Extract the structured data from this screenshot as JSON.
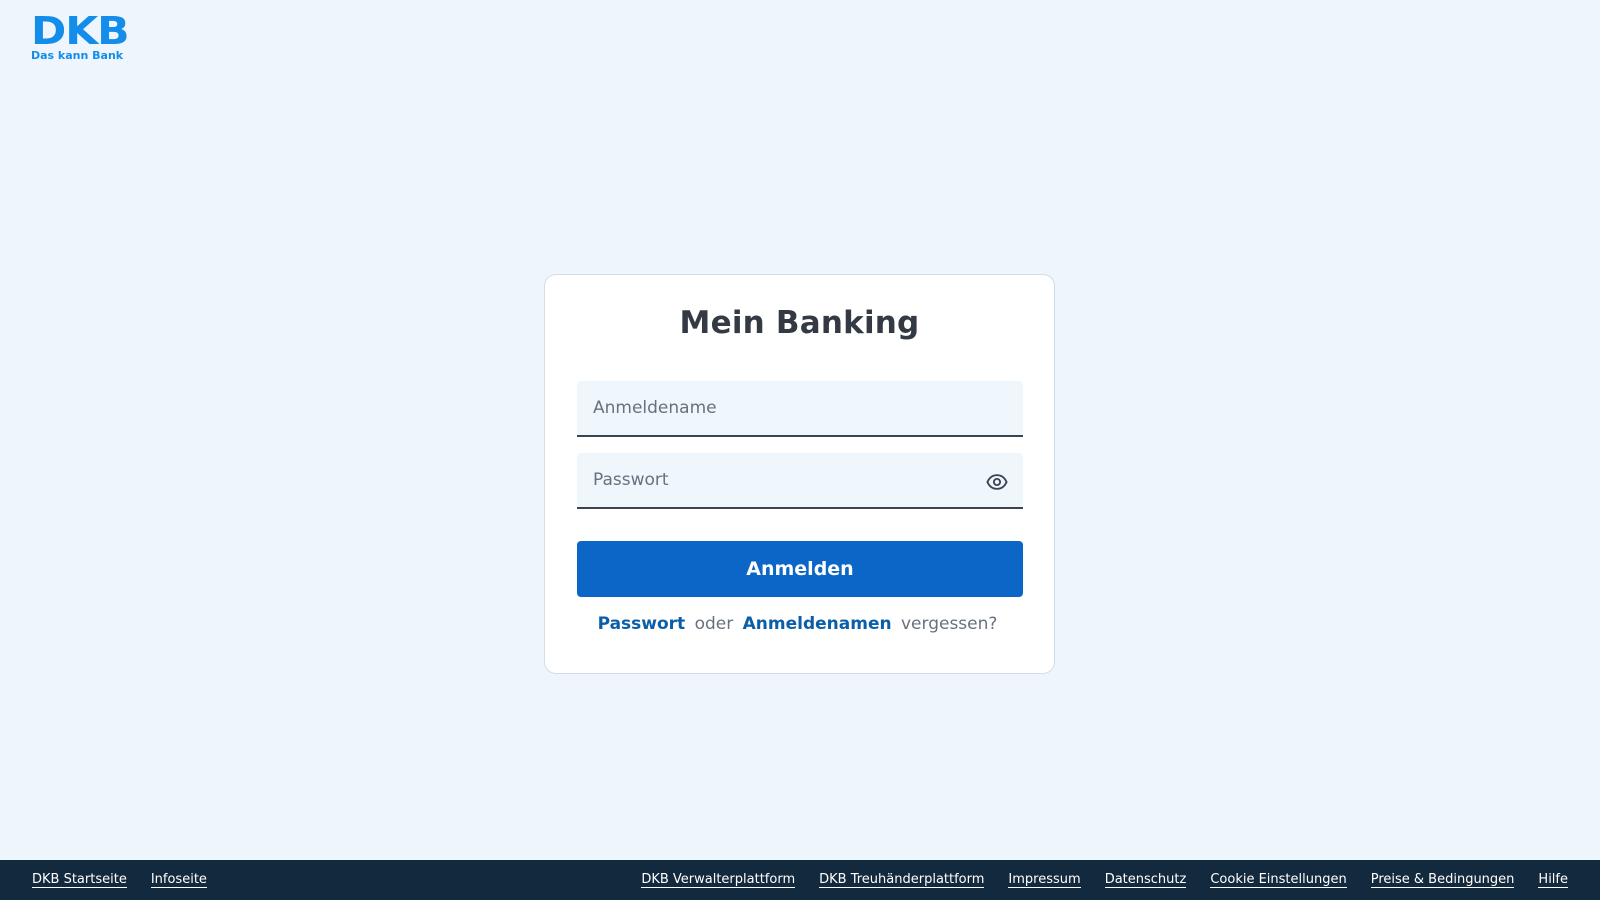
{
  "logo": {
    "mark": "DKB",
    "tagline": "Das kann Bank"
  },
  "card": {
    "title": "Mein Banking",
    "username_placeholder": "Anmeldename",
    "password_placeholder": "Passwort",
    "submit_label": "Anmelden",
    "forgot": {
      "password_link": "Passwort",
      "or_text": "oder",
      "username_link": "Anmeldenamen",
      "suffix_text": "vergessen?"
    }
  },
  "footer": {
    "left_links": [
      "DKB Startseite",
      "Infoseite"
    ],
    "right_links": [
      "DKB Verwalterplattform",
      "DKB Treuhänderplattform",
      "Impressum",
      "Datenschutz",
      "Cookie Einstellungen",
      "Preise & Bedingungen",
      "Hilfe"
    ]
  },
  "colors": {
    "background": "#eef5fc",
    "brand": "#148dea",
    "primary_button": "#0b66c8",
    "link": "#0b5ea8",
    "footer": "#13293d"
  },
  "icons": {
    "password_toggle": "eye-icon"
  }
}
